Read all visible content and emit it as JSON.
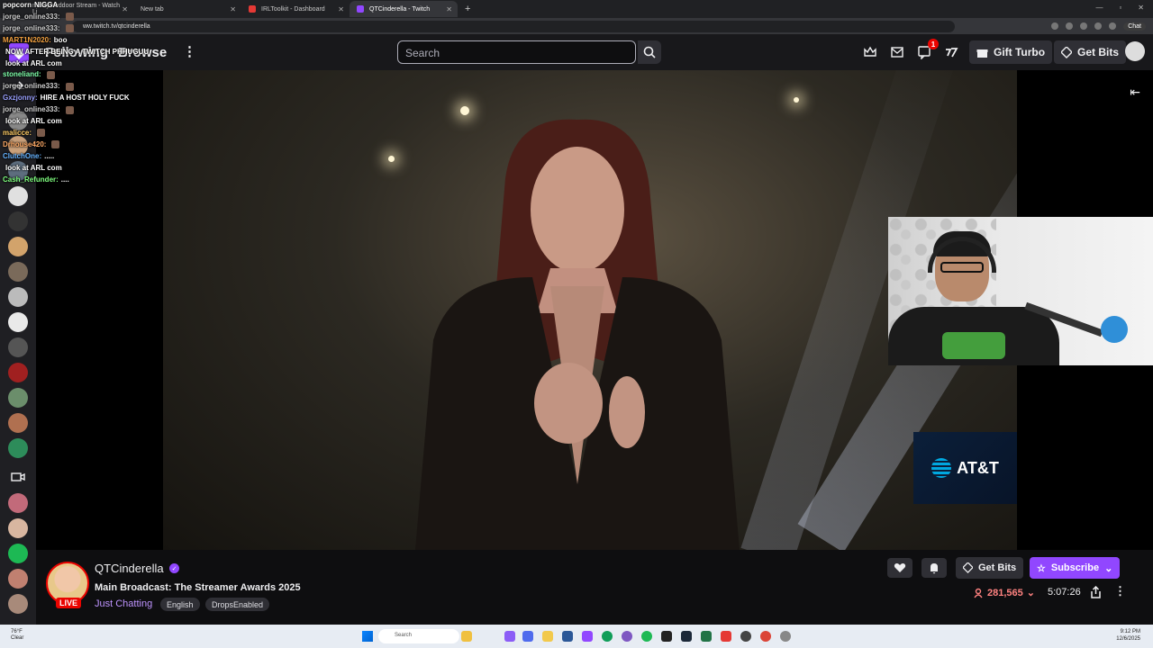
{
  "browser": {
    "tabs": [
      {
        "title": "markymeddoor Stream - Watch Li"
      },
      {
        "title": "New tab"
      },
      {
        "title": "IRLToolkit - Dashboard"
      },
      {
        "title": "QTCinderella - Twitch"
      }
    ],
    "url": "ww.twitch.tv/qtcinderella",
    "chat_button": "Chat"
  },
  "nav": {
    "following": "Following",
    "browse": "Browse",
    "more": "⋮",
    "search_placeholder": "Search",
    "notification_count": "1",
    "gift_turbo": "Gift Turbo",
    "get_bits": "Get Bits"
  },
  "chat_overlay": [
    {
      "user": "popcorn",
      "color": "#ffffff",
      "msg": "NIGGA",
      "emote": false
    },
    {
      "user": "jorge_online333:",
      "color": "#d0d0d0",
      "msg": "",
      "emote": true
    },
    {
      "user": "jorge_online333:",
      "color": "#d0d0d0",
      "msg": "",
      "emote": true
    },
    {
      "user": "MART1N2020:",
      "color": "#f0a040",
      "msg": "boo",
      "emote": false
    },
    {
      "user": "",
      "color": "#ff4060",
      "msg": "NOW AFTER BEING A TWITCH PHHUGUU",
      "emote": false
    },
    {
      "user": "",
      "color": "#ff4060",
      "msg": "look at ARL com",
      "emote": false
    },
    {
      "user": "stoneliand:",
      "color": "#7fffaa",
      "msg": "",
      "emote": true
    },
    {
      "user": "jorge_online333:",
      "color": "#d0d0d0",
      "msg": "",
      "emote": true
    },
    {
      "user": "Gxzjonny:",
      "color": "#9aa0ff",
      "msg": "HIRE A HOST HOLY FUCK",
      "emote": false
    },
    {
      "user": "jorge_online333:",
      "color": "#d0d0d0",
      "msg": "",
      "emote": true
    },
    {
      "user": "",
      "color": "#ff4060",
      "msg": "look at ARL com",
      "emote": false
    },
    {
      "user": "malicce:",
      "color": "#ffcc66",
      "msg": "",
      "emote": true
    },
    {
      "user": "Drhouse420:",
      "color": "#ffaa66",
      "msg": "",
      "emote": true
    },
    {
      "user": "ClutchOne:",
      "color": "#66b3ff",
      "msg": ".....",
      "emote": false
    },
    {
      "user": "",
      "color": "#ff4060",
      "msg": "look at ARL com",
      "emote": false
    },
    {
      "user": "Cash_Refunder:",
      "color": "#7fff7f",
      "msg": "....",
      "emote": false
    }
  ],
  "channel": {
    "name": "QTCinderella",
    "live": "LIVE",
    "title": "Main Broadcast: The Streamer Awards 2025",
    "category": "Just Chatting",
    "tags": [
      "English",
      "DropsEnabled"
    ],
    "viewers": "281,565",
    "uptime": "5:07:26",
    "get_bits": "Get Bits",
    "subscribe": "Subscribe"
  },
  "video": {
    "sponsor": "AT&T"
  },
  "taskbar": {
    "weather_temp": "76°F",
    "weather_desc": "Clear",
    "search": "Search",
    "time": "9:12 PM",
    "date": "12/6/2025"
  },
  "colors": {
    "twitch_purple": "#9147ff",
    "live_red": "#eb0400",
    "viewer_red": "#ff8280"
  }
}
